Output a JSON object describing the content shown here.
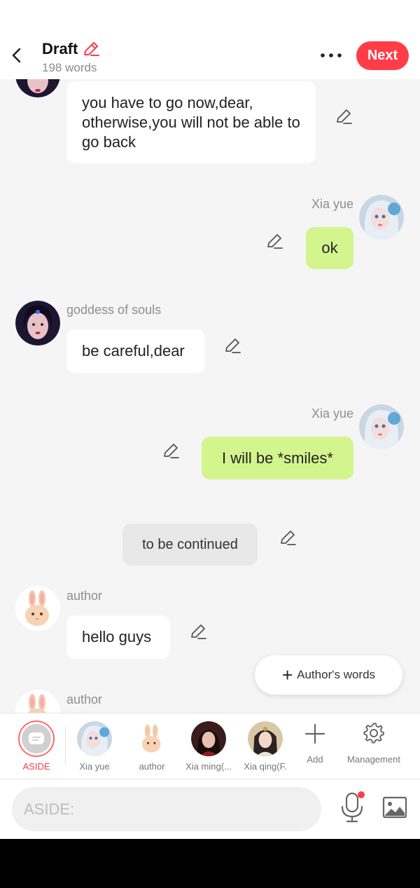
{
  "header": {
    "title": "Draft",
    "word_count": "198 words",
    "next_label": "Next"
  },
  "messages": [
    {
      "speaker": "",
      "text": "you have to go now,dear, otherwise,you will not be able to go back"
    },
    {
      "speaker": "Xia yue",
      "text": "ok"
    },
    {
      "speaker": "goddess of souls",
      "text": "be careful,dear"
    },
    {
      "speaker": "Xia yue",
      "text": "I will be *smiles*"
    },
    {
      "speaker": "",
      "text": "to be continued"
    },
    {
      "speaker": "author",
      "text": "hello guys"
    },
    {
      "speaker": "author",
      "text": ""
    }
  ],
  "float_button": {
    "label": "Author's words"
  },
  "roles": [
    {
      "label": "ASIDE"
    },
    {
      "label": "Xia yue"
    },
    {
      "label": "author"
    },
    {
      "label": "Xia ming(..."
    },
    {
      "label": "Xia qing(F."
    },
    {
      "label": "Add"
    },
    {
      "label": "Management"
    }
  ],
  "input": {
    "placeholder": "ASIDE:"
  },
  "colors": {
    "accent": "#ff3d49",
    "self_bubble": "#d4f48e",
    "other_bubble": "#ffffff",
    "aside_bubble": "#e8e8e8",
    "background": "#f5f5f5"
  },
  "icons": [
    "back-arrow-icon",
    "pencil-icon",
    "more-icon",
    "plus-icon",
    "gear-icon",
    "mic-icon",
    "image-icon"
  ]
}
